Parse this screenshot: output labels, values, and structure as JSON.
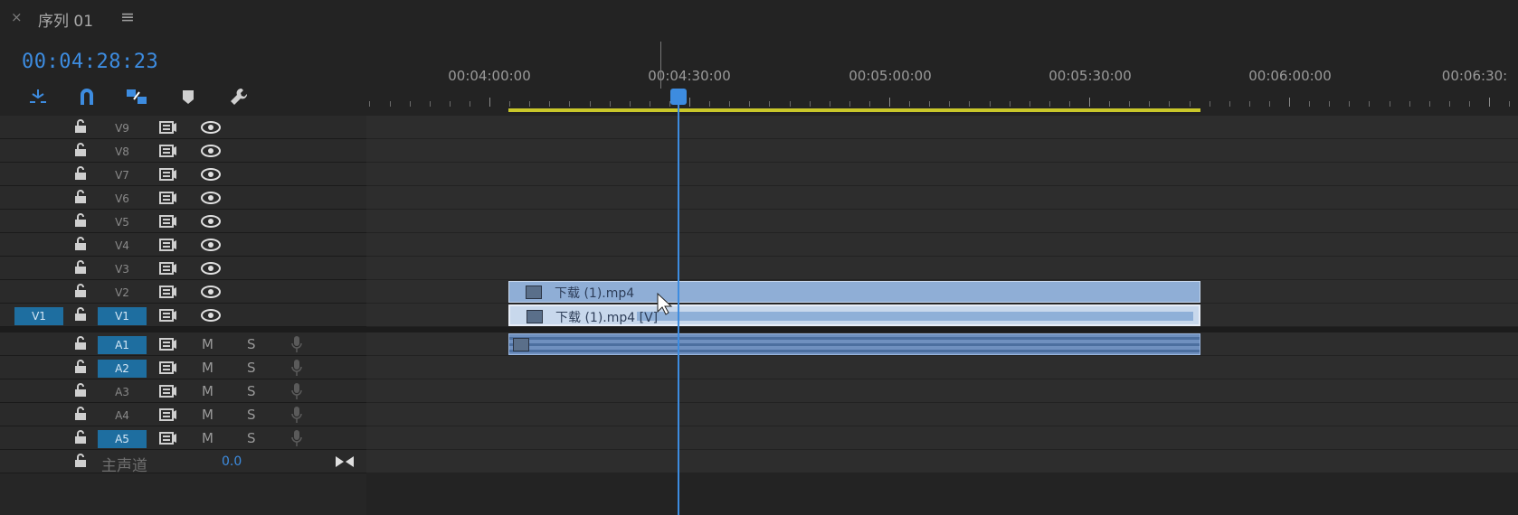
{
  "panel": {
    "close_label": "×",
    "sequence_title": "序列 01",
    "menu_label": "≡"
  },
  "timecode": "00:04:28:23",
  "toolbar": {
    "tools": [
      "snap-nested-icon",
      "magnet-icon",
      "linked-selection-icon",
      "add-marker-icon",
      "wrench-icon"
    ]
  },
  "ruler": {
    "labels": [
      "00:04:00:00",
      "00:04:30:00",
      "00:05:00:00",
      "00:05:30:00",
      "00:06:00:00",
      "00:06:30:"
    ]
  },
  "source_patch": "V1",
  "video_tracks": [
    {
      "name": "V9",
      "targeted": false
    },
    {
      "name": "V8",
      "targeted": false
    },
    {
      "name": "V7",
      "targeted": false
    },
    {
      "name": "V6",
      "targeted": false
    },
    {
      "name": "V5",
      "targeted": false
    },
    {
      "name": "V4",
      "targeted": false
    },
    {
      "name": "V3",
      "targeted": false
    },
    {
      "name": "V2",
      "targeted": false
    },
    {
      "name": "V1",
      "targeted": true
    }
  ],
  "audio_tracks": [
    {
      "name": "A1",
      "targeted": true,
      "m": "M",
      "s": "S"
    },
    {
      "name": "A2",
      "targeted": true,
      "m": "M",
      "s": "S"
    },
    {
      "name": "A3",
      "targeted": false,
      "m": "M",
      "s": "S"
    },
    {
      "name": "A4",
      "targeted": false,
      "m": "M",
      "s": "S"
    },
    {
      "name": "A5",
      "targeted": true,
      "m": "M",
      "s": "S"
    }
  ],
  "master": {
    "label": "主声道",
    "value": "0.0"
  },
  "clips": {
    "v2_clip": "下载 (1).mp4",
    "v1_clip": "下载 (1).mp4 [V]"
  },
  "colors": {
    "accent": "#3d8ce0",
    "work_area": "#c9c72a",
    "clip": "#8faed6"
  }
}
